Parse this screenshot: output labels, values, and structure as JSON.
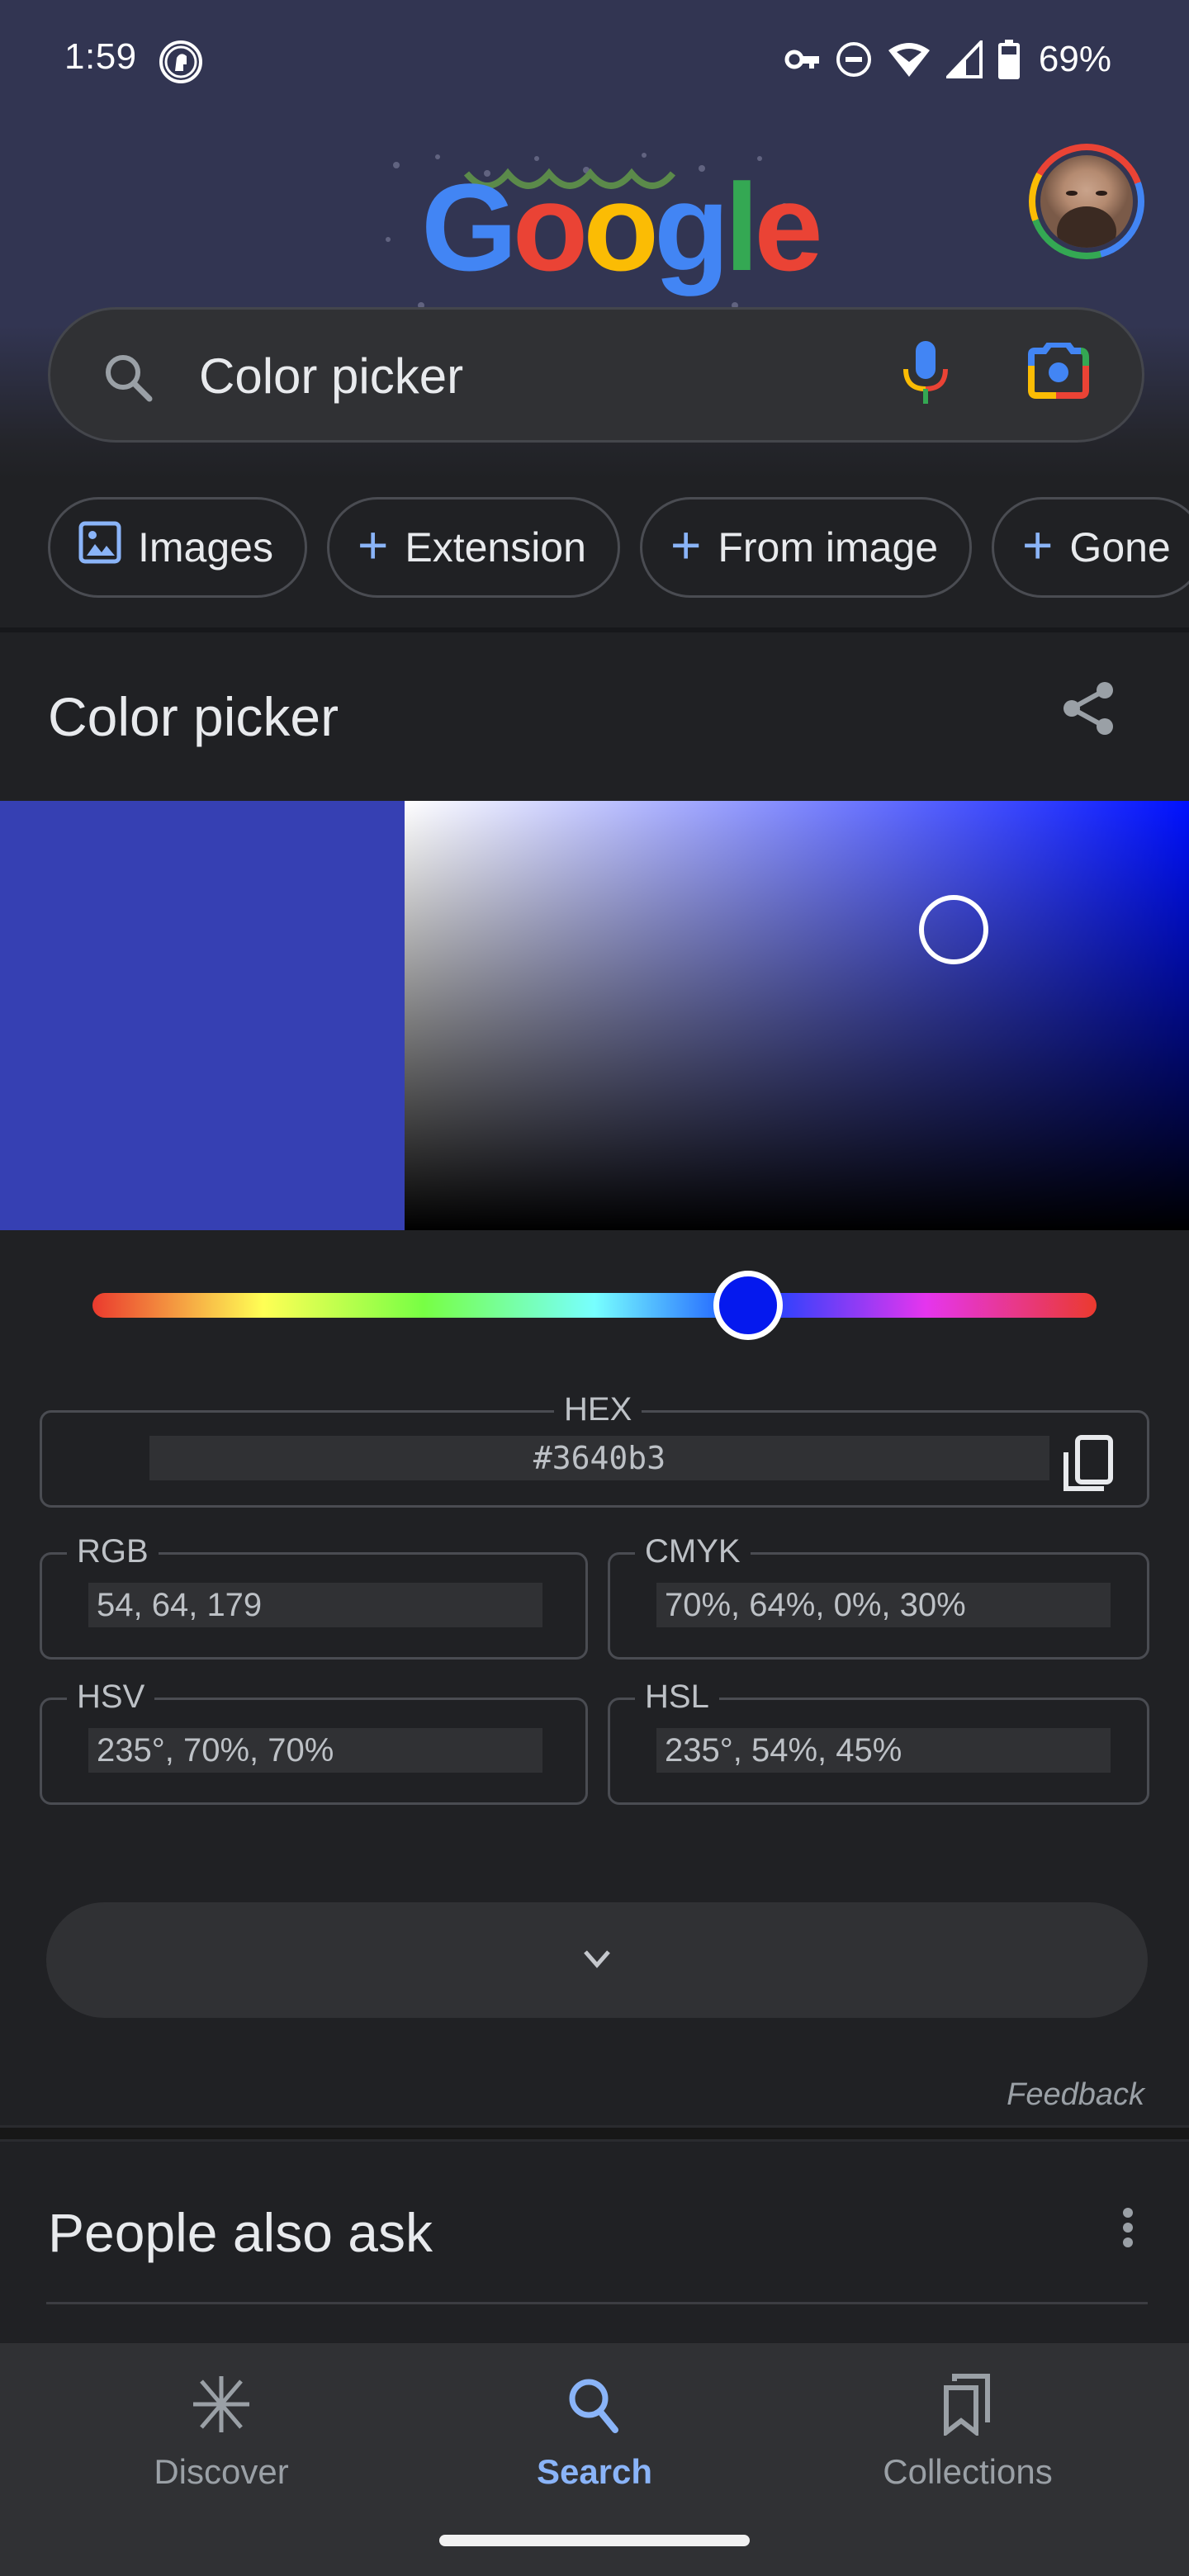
{
  "status_bar": {
    "time": "1:59",
    "battery_percent": "69%",
    "icons": [
      "app-notification-icon",
      "vpn-key-icon",
      "do-not-disturb-icon",
      "wifi-icon",
      "cell-signal-icon",
      "battery-icon"
    ]
  },
  "header": {
    "logo_text": "Google",
    "logo_letters": [
      {
        "char": "G",
        "color": "#4285f4"
      },
      {
        "char": "o",
        "color": "#ea4335"
      },
      {
        "char": "o",
        "color": "#fbbc04"
      },
      {
        "char": "g",
        "color": "#4285f4"
      },
      {
        "char": "l",
        "color": "#34a853"
      },
      {
        "char": "e",
        "color": "#ea4335"
      }
    ],
    "avatar_label": "Account"
  },
  "search": {
    "query": "Color picker",
    "icons": [
      "search-icon",
      "mic-icon",
      "lens-camera-icon"
    ]
  },
  "chips": [
    {
      "label": "Images",
      "icon": "image-icon"
    },
    {
      "label": "Extension",
      "icon": "plus-icon"
    },
    {
      "label": "From image",
      "icon": "plus-icon"
    },
    {
      "label": "Gone",
      "icon": "plus-icon"
    }
  ],
  "color_picker": {
    "title": "Color picker",
    "selected_color": "#3640b3",
    "hue_degrees": 235,
    "saturation_percent": 70,
    "value_percent": 70,
    "fields": {
      "hex": {
        "label": "HEX",
        "value": "#3640b3"
      },
      "rgb": {
        "label": "RGB",
        "value": "54, 64, 179"
      },
      "cmyk": {
        "label": "CMYK",
        "value": "70%, 64%, 0%, 30%"
      },
      "hsv": {
        "label": "HSV",
        "value": "235°, 70%, 70%"
      },
      "hsl": {
        "label": "HSL",
        "value": "235°, 54%, 45%"
      }
    },
    "feedback_label": "Feedback"
  },
  "people_also_ask": {
    "title": "People also ask"
  },
  "bottom_nav": {
    "items": [
      {
        "label": "Discover",
        "icon": "discover-asterisk-icon",
        "active": false
      },
      {
        "label": "Search",
        "icon": "search-icon",
        "active": true
      },
      {
        "label": "Collections",
        "icon": "collections-bookmark-icon",
        "active": false
      }
    ]
  },
  "colors": {
    "accent": "#8ab4f8",
    "background": "#202124",
    "header_background": "#323552",
    "surface": "#303134"
  }
}
